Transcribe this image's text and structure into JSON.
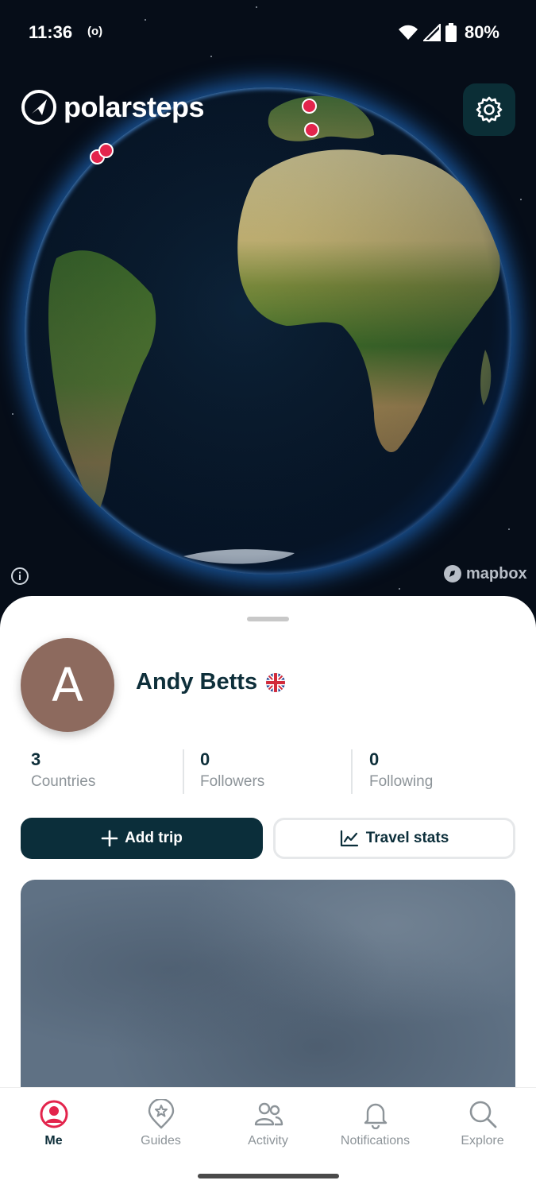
{
  "status_bar": {
    "time": "11:36",
    "hotspot": "(o)",
    "battery": "80%",
    "icons": [
      "wifi-icon",
      "signal-icon",
      "battery-icon"
    ]
  },
  "app": {
    "brand": "polarsteps",
    "logo_icon": "compass-icon",
    "settings_icon": "gear-icon",
    "map_attribution": "mapbox"
  },
  "profile": {
    "initial": "A",
    "name": "Andy Betts",
    "flag_icon": "uk-flag-icon",
    "avatar_color": "#8d6a5e"
  },
  "stats": [
    {
      "value": "3",
      "label": "Countries"
    },
    {
      "value": "0",
      "label": "Followers"
    },
    {
      "value": "0",
      "label": "Following"
    }
  ],
  "actions": {
    "add_trip": "Add trip",
    "travel_stats": "Travel stats"
  },
  "nav": {
    "items": [
      {
        "label": "Me",
        "icon": "profile-icon",
        "active": true
      },
      {
        "label": "Guides",
        "icon": "guide-badge-icon",
        "active": false
      },
      {
        "label": "Activity",
        "icon": "people-icon",
        "active": false
      },
      {
        "label": "Notifications",
        "icon": "bell-icon",
        "active": false
      },
      {
        "label": "Explore",
        "icon": "search-icon",
        "active": false
      }
    ]
  },
  "colors": {
    "primary": "#0b2e3a",
    "accent_red": "#e3244c",
    "globe_glow": "#2580e6"
  }
}
